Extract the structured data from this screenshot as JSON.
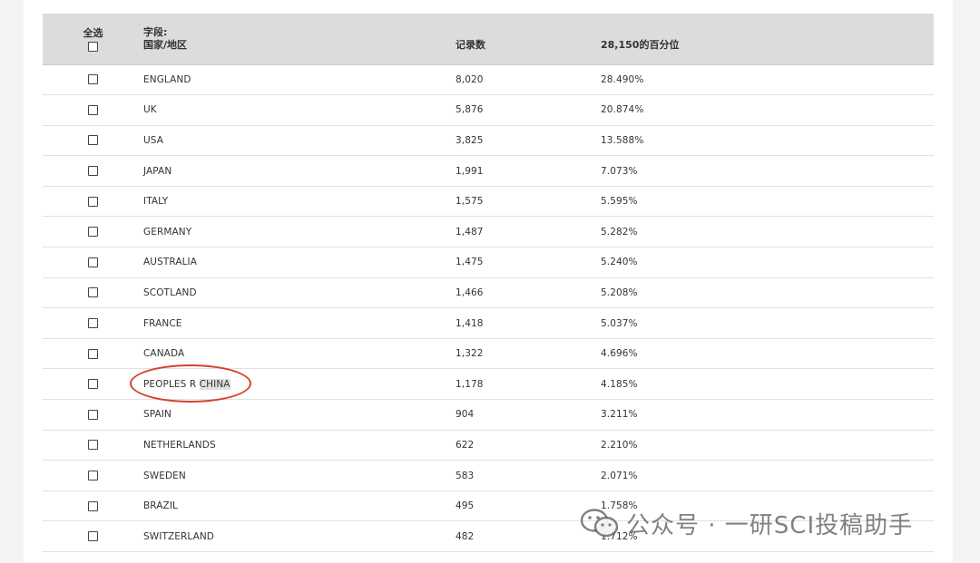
{
  "header": {
    "select_all": "全选",
    "field_label_line1": "字段:",
    "field_label_line2": "国家/地区",
    "count_label": "记录数",
    "percent_label": "28,150的百分位"
  },
  "rows": [
    {
      "name": "ENGLAND",
      "count": "8,020",
      "percent": "28.490%"
    },
    {
      "name": "UK",
      "count": "5,876",
      "percent": "20.874%"
    },
    {
      "name": "USA",
      "count": "3,825",
      "percent": "13.588%"
    },
    {
      "name": "JAPAN",
      "count": "1,991",
      "percent": "7.073%"
    },
    {
      "name": "ITALY",
      "count": "1,575",
      "percent": "5.595%"
    },
    {
      "name": "GERMANY",
      "count": "1,487",
      "percent": "5.282%"
    },
    {
      "name": "AUSTRALIA",
      "count": "1,475",
      "percent": "5.240%"
    },
    {
      "name": "SCOTLAND",
      "count": "1,466",
      "percent": "5.208%"
    },
    {
      "name": "FRANCE",
      "count": "1,418",
      "percent": "5.037%"
    },
    {
      "name": "CANADA",
      "count": "1,322",
      "percent": "4.696%"
    },
    {
      "name_prefix": "PEOPLES R",
      "name_highlight": "CHINA",
      "count": "1,178",
      "percent": "4.185%"
    },
    {
      "name": "SPAIN",
      "count": "904",
      "percent": "3.211%"
    },
    {
      "name": "NETHERLANDS",
      "count": "622",
      "percent": "2.210%"
    },
    {
      "name": "SWEDEN",
      "count": "583",
      "percent": "2.071%"
    },
    {
      "name": "BRAZIL",
      "count": "495",
      "percent": "1.758%"
    },
    {
      "name": "SWITZERLAND",
      "count": "482",
      "percent": "1.712%"
    }
  ],
  "watermark": {
    "text": "公众号 · 一研SCI投稿助手",
    "icon": "wechat-icon"
  },
  "colors": {
    "header_bg": "#dcdcdc",
    "annotation": "#d9402f",
    "highlight": "#e0e0e0"
  }
}
